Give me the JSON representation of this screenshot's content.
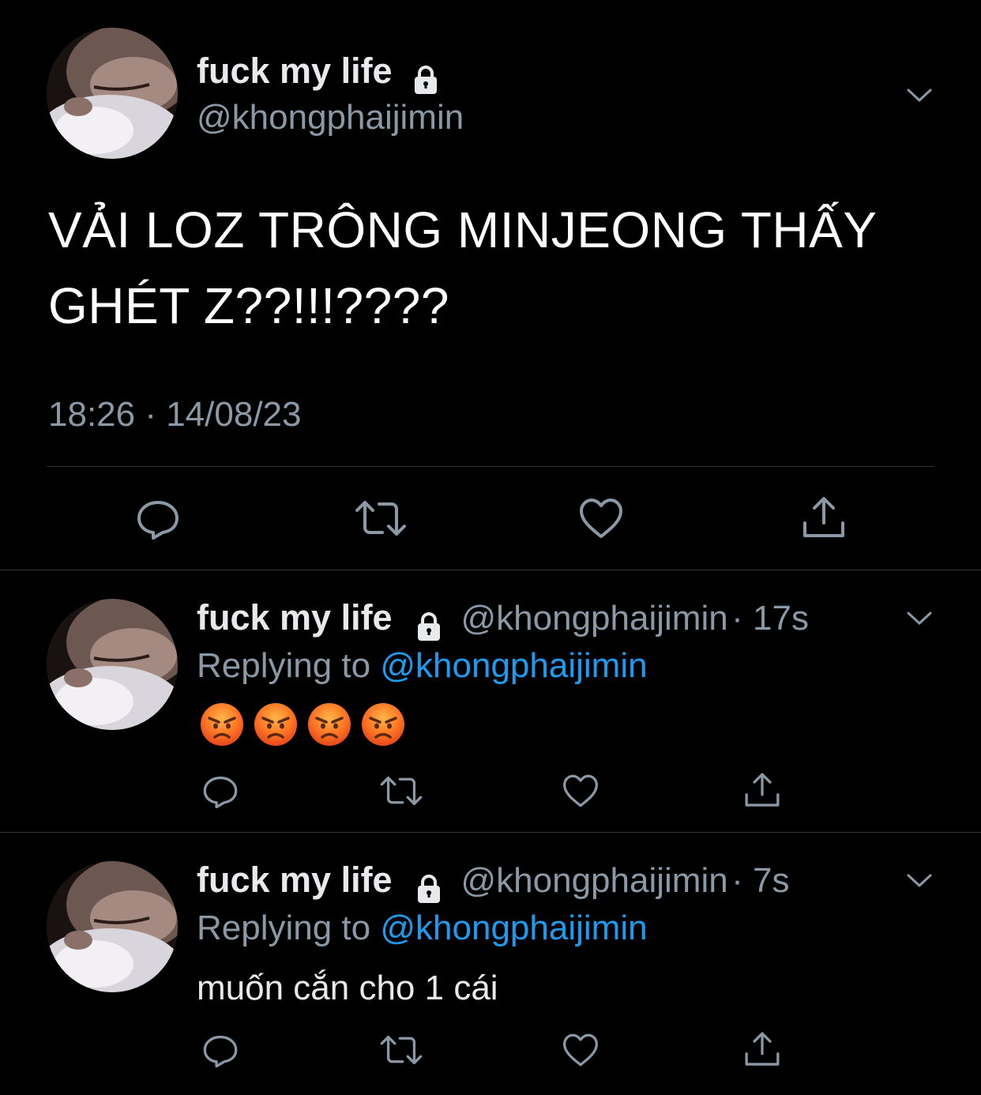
{
  "main_tweet": {
    "display_name": "fuck my life",
    "handle": "@khongphaijimin",
    "text_line1": "VẢI LOZ TRÔNG MINJEONG THẤY",
    "text_line2": "GHÉT Z??!!!????",
    "timestamp": "18:26 · 14/08/23"
  },
  "replies": [
    {
      "display_name": "fuck my life",
      "handle": "@khongphaijimin",
      "time": "· 17s",
      "replying_prefix": "Replying to",
      "replying_to": "@khongphaijimin",
      "content_emojis": [
        "angry-face",
        "angry-face",
        "angry-face",
        "angry-face"
      ]
    },
    {
      "display_name": "fuck my life",
      "handle": "@khongphaijimin",
      "time": "· 7s",
      "replying_prefix": "Replying to",
      "replying_to": "@khongphaijimin",
      "text": "muốn cắn cho 1 cái"
    }
  ],
  "icons": {
    "protected": "lock-icon",
    "more": "chevron-down-icon",
    "reply": "reply-icon",
    "retweet": "retweet-icon",
    "like": "heart-icon",
    "share": "share-icon"
  },
  "colors": {
    "background": "#000000",
    "text": "#e7e9ea",
    "secondary": "#8b98a5",
    "link": "#1d9bf0",
    "divider": "#2f3336"
  }
}
